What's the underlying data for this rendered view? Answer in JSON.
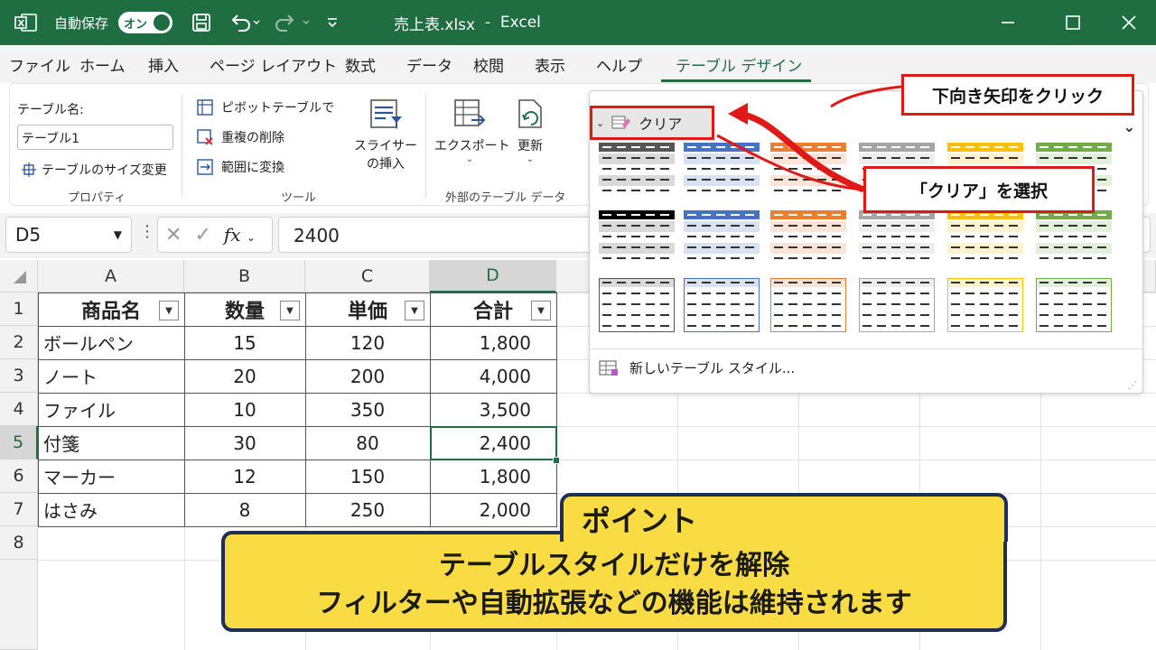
{
  "titlebar": {
    "autosave_label": "自動保存",
    "toggle_state": "オン",
    "filename": "売上表.xlsx",
    "separator": "-",
    "app": "Excel"
  },
  "tabs": [
    "ファイル",
    "ホーム",
    "挿入",
    "ページ レイアウト",
    "数式",
    "データ",
    "校閲",
    "表示",
    "ヘルプ",
    "テーブル デザイン"
  ],
  "active_tab": "テーブル デザイン",
  "ribbon": {
    "table_name_label": "テーブル名:",
    "table_name_value": "テーブル1",
    "resize_label": "テーブルのサイズ変更",
    "group_properties": "プロパティ",
    "pivot_label": "ピボットテーブルで",
    "remove_dup_label": "重複の削除",
    "convert_label": "範囲に変換",
    "slicer_line1": "スライサー",
    "slicer_line2": "の挿入",
    "group_tools": "ツール",
    "export_label": "エクスポート",
    "refresh_label": "更新",
    "group_external": "外部のテーブル データ"
  },
  "formula_bar": {
    "name_box": "D5",
    "fx": "fx",
    "value": "2400"
  },
  "columns": [
    "A",
    "B",
    "C",
    "D"
  ],
  "rows": [
    "1",
    "2",
    "3",
    "4",
    "5",
    "6",
    "7",
    "8"
  ],
  "table": {
    "headers": [
      "商品名",
      "数量",
      "単価",
      "合計"
    ],
    "data": [
      [
        "ボールペン",
        "15",
        "120",
        "1,800"
      ],
      [
        "ノート",
        "20",
        "200",
        "4,000"
      ],
      [
        "ファイル",
        "10",
        "350",
        "3,500"
      ],
      [
        "付箋",
        "30",
        "80",
        "2,400"
      ],
      [
        "マーカー",
        "12",
        "150",
        "1,800"
      ],
      [
        "はさみ",
        "8",
        "250",
        "2,000"
      ]
    ]
  },
  "gallery": {
    "clear_label": "クリア",
    "new_style_label": "新しいテーブル スタイル..."
  },
  "swatch_colors": [
    "#555555",
    "#4472c4",
    "#ed7d31",
    "#a5a5a5",
    "#ffc000",
    "#70ad47"
  ],
  "callouts": {
    "arrow_hint": "下向き矢印をクリック",
    "select_hint": "「クリア」を選択"
  },
  "point": {
    "title": "ポイント",
    "line1": "テーブルスタイルだけを解除",
    "line2": "フィルターや自動拡張などの機能は維持されます"
  },
  "colors": {
    "title_bar": "#1e6e42",
    "accent": "#e01818",
    "point_bg": "#f9dc44",
    "point_border": "#1e2e55"
  }
}
